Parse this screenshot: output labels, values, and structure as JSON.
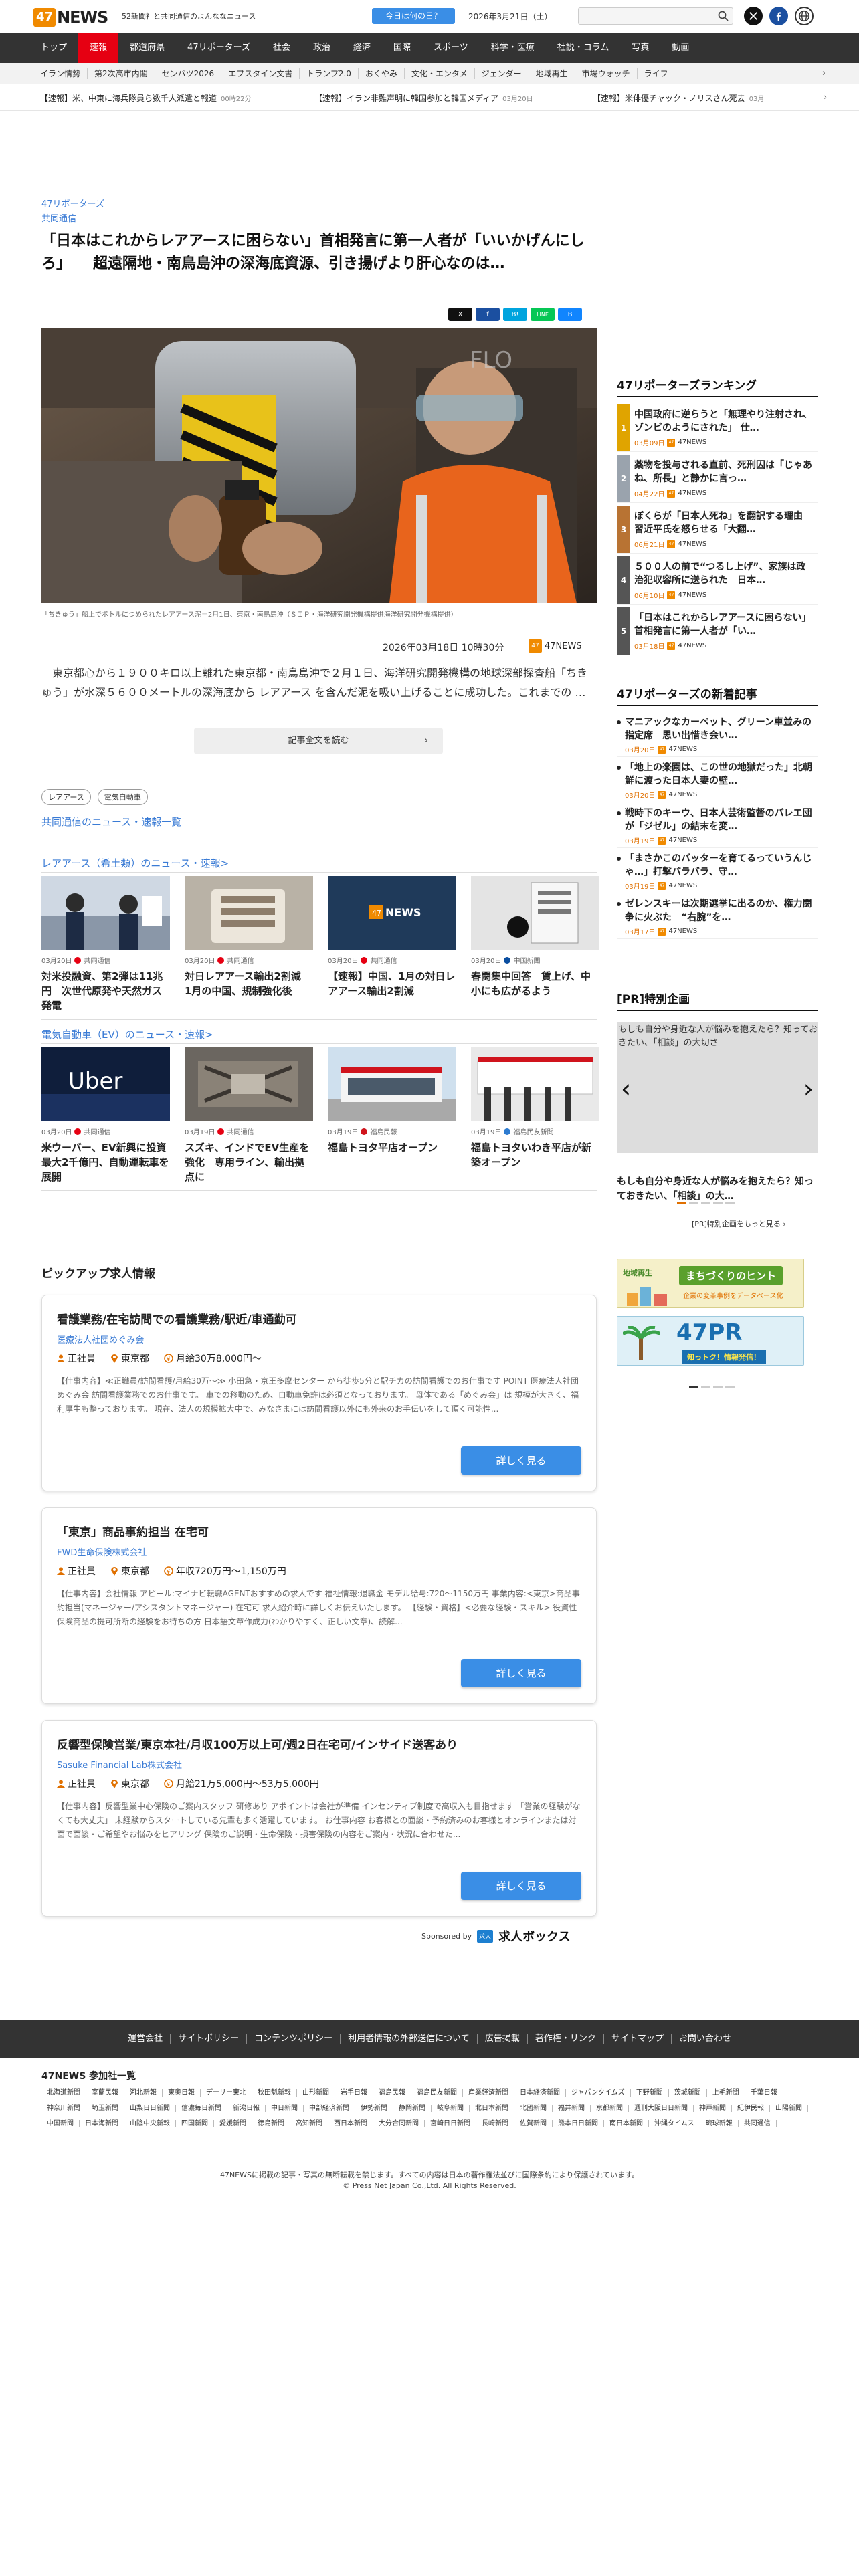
{
  "header": {
    "logo_num": "47",
    "logo_text": "NEWS",
    "tagline": "52新聞社と共同通信のよんななニュース",
    "today_button": "今日は何の日？",
    "date": "2026年3月21日（土）",
    "search_placeholder": ""
  },
  "nav": [
    "トップ",
    "速報",
    "都道府県",
    "47リポーターズ",
    "社会",
    "政治",
    "経済",
    "国際",
    "スポーツ",
    "科学・医療",
    "社説・コラム",
    "写真",
    "動画"
  ],
  "subnav": [
    "イラン情勢",
    "第2次高市内閣",
    "センバツ2026",
    "エプスタイン文書",
    "トランプ2.0",
    "おくやみ",
    "文化・エンタメ",
    "ジェンダー",
    "地域再生",
    "市場ウォッチ",
    "ライフ"
  ],
  "ticker": [
    {
      "text": "【速報】米、中東に海兵隊員ら数千人派遣と報道",
      "time": "00時22分"
    },
    {
      "text": "【速報】イラン非難声明に韓国参加と韓国メディア",
      "time": "03月20日"
    },
    {
      "text": "【速報】米俳優チャック・ノリスさん死去",
      "time": "03月"
    }
  ],
  "article": {
    "category": "47リポーターズ",
    "source_label": "共同通信",
    "headline": "「日本はこれからレアアースに困らない」首相発言に第一人者が「いいかげんにしろ」　　超遠隔地・南鳥島沖の深海底資源、引き揚げより肝心なのは…",
    "share": [
      "X",
      "f",
      "B!",
      "LINE",
      "B"
    ],
    "caption": "「ちきゅう」船上でボトルにつめられたレアアース泥＝2月1日、東京・南鳥島沖（ＳＩＰ・海洋研究開発機構提供海洋研究開発機構提供）",
    "published": "2026年03月18日 10時30分",
    "publisher": "47NEWS",
    "publisher_badge": "47",
    "lead": "　東京都心から１９００キロ以上離れた東京都・南鳥島沖で２月１日、海洋研究開発機構の地球深部探査船「ちきゅう」が水深５６００メートルの深海底から レアアース を含んだ泥を吸い上げることに成功した。これまでの …",
    "read_more": "記事全文を読む",
    "tags": [
      "レアアース",
      "電気自動車"
    ],
    "kyodo_link": "共同通信のニュース・速報一覧"
  },
  "section_rare": {
    "title": "レアアース（希土類）のニュース・速報>",
    "cards": [
      {
        "date": "03月20日",
        "source": "共同通信",
        "title": "対米投融資、第2弾は11兆円　次世代原発や天然ガス発電"
      },
      {
        "date": "03月20日",
        "source": "共同通信",
        "title": "対日レアアース輸出2割減　1月の中国、規制強化後"
      },
      {
        "date": "03月20日",
        "source": "共同通信",
        "title": "【速報】中国、1月の対日レアアース輸出2割減"
      },
      {
        "date": "03月20日",
        "source": "中国新聞",
        "title": "春闘集中回答　賃上げ、中小にも広がるよう"
      }
    ]
  },
  "section_ev": {
    "title": "電気自動車（EV）のニュース・速報>",
    "cards": [
      {
        "date": "03月20日",
        "source": "共同通信",
        "title": "米ウーバー、EV新興に投資　最大2千億円、自動運転車を展開"
      },
      {
        "date": "03月19日",
        "source": "共同通信",
        "title": "スズキ、インドでEV生産を強化　専用ライン、輸出拠点に"
      },
      {
        "date": "03月19日",
        "source": "福島民報",
        "title": "福島トヨタ平店オープン"
      },
      {
        "date": "03月19日",
        "source": "福島民友新聞",
        "title": "福島トヨタいわき平店が新築オープン"
      }
    ]
  },
  "jobs": {
    "title": "ピックアップ求人情報",
    "items": [
      {
        "title": "看護業務/在宅訪問での看護業務/駅近/車通勤可",
        "company": "医療法人社団めぐみ会",
        "type": "正社員",
        "location": "東京都",
        "salary": "月給30万8,000円～",
        "desc": "【仕事内容】≪正職員/訪問看護/月給30万〜≫ 小田急・京王多摩センター から徒歩5分と駅チカの訪問看護でのお仕事です POINT 医療法人社団めぐみ会 訪問看護業務でのお仕事です。 車での移動のため、自動車免許は必須となっております。 母体である「めぐみ会」は 規模が大きく、福利厚生も整っております。 現在、法人の規模拡大中で、みなさまには訪問看護以外にも外来のお手伝いをして頂く可能性...",
        "button": "詳しく見る"
      },
      {
        "title": "「東京」商品事約担当 在宅可",
        "company": "FWD生命保険株式会社",
        "type": "正社員",
        "location": "東京都",
        "salary": "年収720万円～1,150万円",
        "desc": "【仕事内容】会社情報 アピール:マイナビ転職AGENTおすすめの求人です 福祉情報:退職金 モデル給与:720〜1150万円 事業内容:<東京>商品事約担当(マネージャー/アシスタントマネージャー) 在宅可 求人紹介時に詳しくお伝えいたします。 【経験・資格】<必要な経験・スキル> 役資性保険商品の提可所断の経験をお待ちの方 日本語文章作成力(わかりやすく、正しい文章)、読解...",
        "button": "詳しく見る"
      },
      {
        "title": "反響型保険営業/東京本社/月収100万以上可/週2日在宅可/インサイド送客あり",
        "company": "Sasuke Financial Lab株式会社",
        "type": "正社員",
        "location": "東京都",
        "salary": "月給21万5,000円～53万5,000円",
        "desc": "【仕事内容】反響型業中心保険のご案内スタッフ 研修あり アポイントは会社が準備 インセンティブ制度で高収入も目指せます 「営業の経験がなくても大丈夫」 未経験からスタートしている先輩も多く活躍しています。 お仕事内容 お客様との面談・予約済みのお客様とオンラインまたは対面で面談・ご希望やお悩みをヒアリング 保険のご説明・生命保険・損害保険の内容をご案内・状況に合わせた...",
        "button": "詳しく見る"
      }
    ],
    "sponsored_by": "Sponsored by",
    "sponsor_name": "求人ボックス",
    "sponsor_badge": "求人"
  },
  "ranking": {
    "title": "47リポーターズランキング",
    "items": [
      {
        "num": "1",
        "title": "中国政府に逆らうと「無理やり注射され、ゾンビのようにされた」 仕…",
        "date": "03月09日",
        "src": "47NEWS"
      },
      {
        "num": "2",
        "title": "薬物を投与される直前、死刑囚は「じゃあね、所長」と静かに言っ…",
        "date": "04月22日",
        "src": "47NEWS"
      },
      {
        "num": "3",
        "title": "ぼくらが「日本人死ね」を翻訳する理由　習近平氏を怒らせる「大翻…",
        "date": "06月21日",
        "src": "47NEWS"
      },
      {
        "num": "4",
        "title": "５００人の前で“つるし上げ”、家族は政治犯収容所に送られた　日本…",
        "date": "06月10日",
        "src": "47NEWS"
      },
      {
        "num": "5",
        "title": "「日本はこれからレアアースに困らない」首相発言に第一人者が「い…",
        "date": "03月18日",
        "src": "47NEWS"
      }
    ]
  },
  "newest": {
    "title": "47リポーターズの新着記事",
    "items": [
      {
        "title": "マニアックなカーペット、グリーン車並みの指定席　思い出惜き会い…",
        "date": "03月20日",
        "src": "47NEWS"
      },
      {
        "title": "「地上の楽園は、この世の地獄だった」北朝鮮に渡った日本人妻の壁…",
        "date": "03月20日",
        "src": "47NEWS"
      },
      {
        "title": "戦時下のキーウ、日本人芸術監督のバレエ団が「ジゼル」の結末を変…",
        "date": "03月19日",
        "src": "47NEWS"
      },
      {
        "title": "「まさかこのバッターを育てるっていうんじゃ…」打撃バラバラ、守…",
        "date": "03月19日",
        "src": "47NEWS"
      },
      {
        "title": "ゼレンスキーは次期選挙に出るのか、権力闘争に火ぶた　“右腕”を…",
        "date": "03月17日",
        "src": "47NEWS"
      }
    ]
  },
  "pr": {
    "title": "[PR]特別企画",
    "image_alt": "もしも自分や身近な人が悩みを抱えたら？知っておきたい、「相談」の大切さ",
    "text": "もしも自分や身近な人が悩みを抱えたら？知っておきたい、「相談」の大…",
    "more": "[PR]特別企画をもっと見る ›",
    "banner1": "まちづくりのヒント",
    "banner1_sub": "企業の変革事例をデータベース化",
    "banner1_label": "地域再生",
    "banner2": "47PR",
    "banner2_sub": "知っトク！情報発信！"
  },
  "footer": {
    "links": [
      "運営会社",
      "サイトポリシー",
      "コンテンツポリシー",
      "利用者情報の外部送信について",
      "広告掲載",
      "著作権・リンク",
      "サイトマップ",
      "お問い合わせ"
    ],
    "papers_title": "47NEWS 参加社一覧",
    "papers": [
      "北海道新聞",
      "室蘭民報",
      "河北新報",
      "東奥日報",
      "デーリー東北",
      "秋田魁新報",
      "山形新聞",
      "岩手日報",
      "福島民報",
      "福島民友新聞",
      "産業経済新聞",
      "日本経済新聞",
      "ジャパンタイムズ",
      "下野新聞",
      "茨城新聞",
      "上毛新聞",
      "千葉日報",
      "神奈川新聞",
      "埼玉新聞",
      "山梨日日新聞",
      "信濃毎日新聞",
      "新潟日報",
      "中日新聞",
      "中部経済新聞",
      "伊勢新聞",
      "静岡新聞",
      "岐阜新聞",
      "北日本新聞",
      "北國新聞",
      "福井新聞",
      "京都新聞",
      "週刊大阪日日新聞",
      "神戸新聞",
      "紀伊民報",
      "山陽新聞",
      "中国新聞",
      "日本海新聞",
      "山陰中央新報",
      "四国新聞",
      "愛媛新聞",
      "徳島新聞",
      "高知新聞",
      "西日本新聞",
      "大分合同新聞",
      "宮崎日日新聞",
      "長崎新聞",
      "佐賀新聞",
      "熊本日日新聞",
      "南日本新聞",
      "沖縄タイムス",
      "琉球新報",
      "共同通信"
    ],
    "copy1": "47NEWSに掲載の記事・写真の無断転載を禁じます。すべての内容は日本の著作権法並びに国際条約により保護されています。",
    "copy2": "© Press Net Japan Co.,Ltd. All Rights Reserved."
  },
  "colors": {
    "accent": "#e60012",
    "link": "#3a7bd5",
    "brand_orange": "#f08a00",
    "button_blue": "#3a8ee6",
    "nav_bg": "#333333"
  }
}
